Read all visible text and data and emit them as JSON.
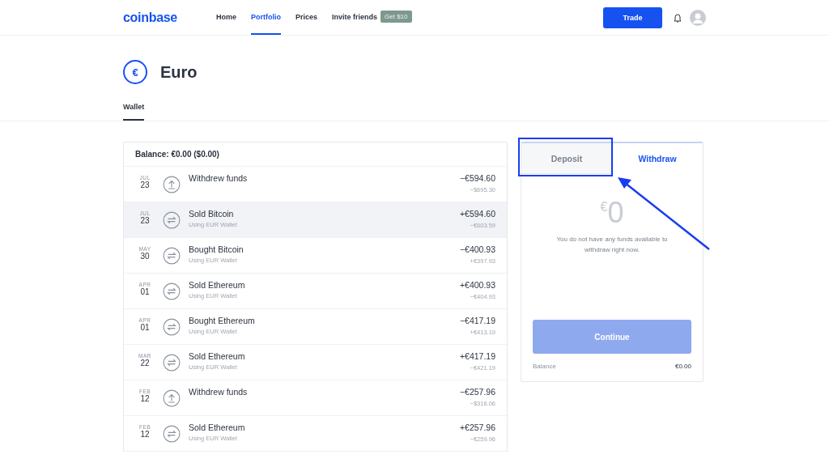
{
  "nav": {
    "logo": "coinbase",
    "items": [
      {
        "label": "Home",
        "selected": false
      },
      {
        "label": "Portfolio",
        "selected": true
      },
      {
        "label": "Prices",
        "selected": false
      },
      {
        "label": "Invite friends",
        "selected": false,
        "badge": "Get $10"
      }
    ],
    "trade_button": "Trade"
  },
  "header": {
    "symbol": "€",
    "title": "Euro",
    "tabs": [
      {
        "label": "Wallet",
        "selected": true
      }
    ]
  },
  "transactions": {
    "balance": "Balance: €0.00 ($0.00)",
    "rows": [
      {
        "kind": "withdraw",
        "month": "JUL",
        "day": "23",
        "title": "Withdrew funds",
        "amount": "−€594.60",
        "secondary": "−$695.30",
        "highlighted": false
      },
      {
        "kind": "trade",
        "month": "JUL",
        "day": "23",
        "title": "Sold Bitcoin",
        "subtitle": "Using EUR Wallet",
        "amount": "+€594.60",
        "secondary": "−€603.59",
        "highlighted": true
      },
      {
        "kind": "trade",
        "month": "MAY",
        "day": "30",
        "title": "Bought Bitcoin",
        "subtitle": "Using EUR Wallet",
        "amount": "−€400.93",
        "secondary": "+€397.93",
        "highlighted": false
      },
      {
        "kind": "trade",
        "month": "APR",
        "day": "01",
        "title": "Sold Ethereum",
        "subtitle": "Using EUR Wallet",
        "amount": "+€400.93",
        "secondary": "−€404.93",
        "highlighted": false
      },
      {
        "kind": "trade",
        "month": "APR",
        "day": "01",
        "title": "Bought Ethereum",
        "subtitle": "Using EUR Wallet",
        "amount": "−€417.19",
        "secondary": "+€413.19",
        "highlighted": false
      },
      {
        "kind": "trade",
        "month": "MAR",
        "day": "22",
        "title": "Sold Ethereum",
        "subtitle": "Using EUR Wallet",
        "amount": "+€417.19",
        "secondary": "−€421.19",
        "highlighted": false
      },
      {
        "kind": "withdraw",
        "month": "FEB",
        "day": "12",
        "title": "Withdrew funds",
        "amount": "−€257.96",
        "secondary": "−$316.06",
        "highlighted": false
      },
      {
        "kind": "trade",
        "month": "FEB",
        "day": "12",
        "title": "Sold Ethereum",
        "subtitle": "Using EUR Wallet",
        "amount": "+€257.96",
        "secondary": "−€259.96",
        "highlighted": false
      }
    ]
  },
  "transfer": {
    "tabs": [
      {
        "label": "Deposit",
        "selected": false
      },
      {
        "label": "Withdraw",
        "selected": true
      }
    ],
    "currency": "€",
    "amount": "0",
    "message": "You do not have any funds available to withdraw right now.",
    "button": {
      "label": "Continue",
      "disabled": true
    },
    "balance_label": "Balance",
    "balance_value": "€0.00"
  }
}
